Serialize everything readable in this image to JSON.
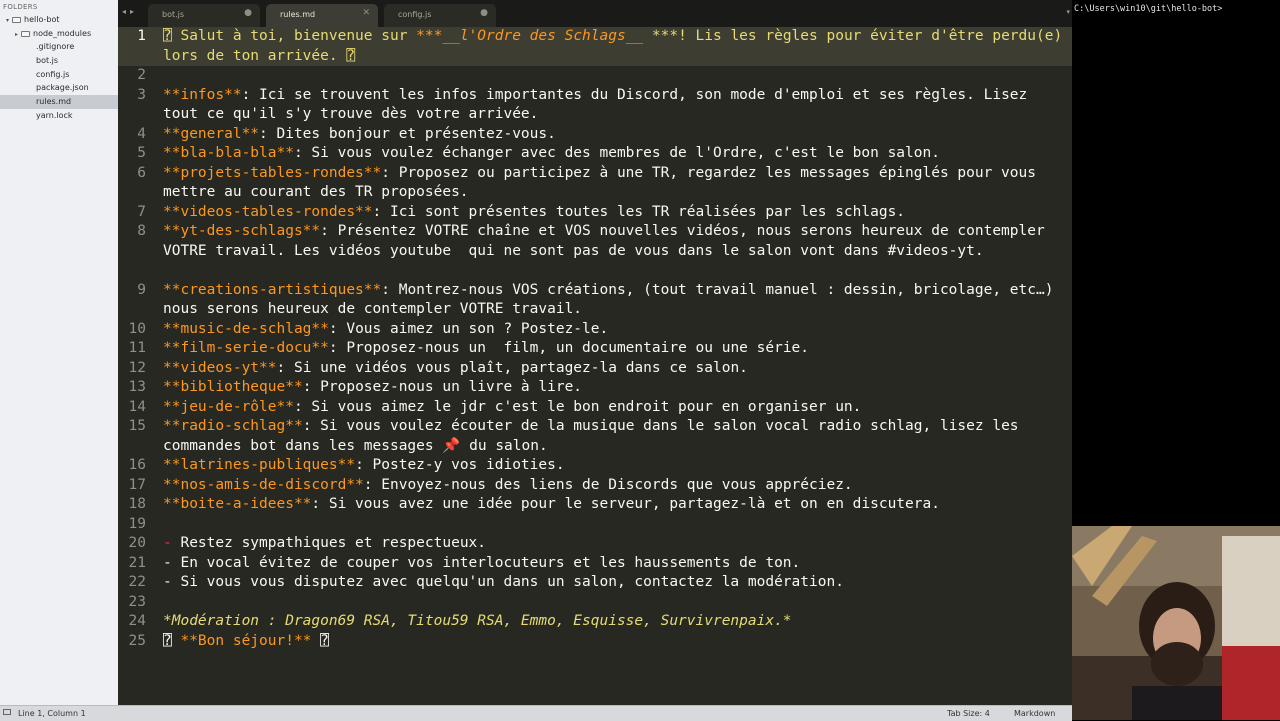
{
  "sidebar": {
    "header": "FOLDERS",
    "root": "hello-bot",
    "items": [
      "node_modules",
      ".gitignore",
      "bot.js",
      "config.js",
      "package.json",
      "rules.md",
      "yarn.lock"
    ]
  },
  "tabs": [
    {
      "label": "bot.js",
      "close": "●"
    },
    {
      "label": "rules.md",
      "close": "✕"
    },
    {
      "label": "config.js",
      "close": "●"
    }
  ],
  "terminal": {
    "prompt": "C:\\Users\\win10\\git\\hello-bot>"
  },
  "status": {
    "position": "Line 1, Column 1",
    "tab_size": "Tab Size: 4",
    "syntax": "Markdown"
  },
  "editor": {
    "line_numbers": [
      "1",
      "2",
      "3",
      "4",
      "5",
      "6",
      "7",
      "8",
      "9",
      "10",
      "11",
      "12",
      "13",
      "14",
      "15",
      "16",
      "17",
      "18",
      "19",
      "20",
      "21",
      "22",
      "23",
      "24",
      "25"
    ],
    "lines": [
      {
        "a": "⍰ Salut à toi, bienvenue sur ",
        "b": "***__",
        "c": "l'Ordre des Schlags__",
        "d": " ***! Lis les règles pour éviter d'être perdu(e) lors de ton arrivée. ⍰"
      },
      {
        "t": ""
      },
      {
        "k": "**infos**",
        "t": ": Ici se trouvent les infos importantes du Discord, son mode d'emploi et ses règles. Lisez tout ce qu'il s'y trouve dès votre arrivée."
      },
      {
        "k": "**general**",
        "t": ": Dites bonjour et présentez-vous."
      },
      {
        "k": "**bla-bla-bla**",
        "t": ": Si vous voulez échanger avec des membres de l'Ordre, c'est le bon salon."
      },
      {
        "k": "**projets-tables-rondes**",
        "t": ": Proposez ou participez à une TR, regardez les messages épinglés pour vous mettre au courant des TR proposées."
      },
      {
        "k": "**videos-tables-rondes**",
        "t": ": Ici sont présentes toutes les TR réalisées par les schlags."
      },
      {
        "k": "**yt-des-schlags**",
        "t": ": Présentez VOTRE chaîne et VOS nouvelles vidéos, nous serons heureux de contempler VOTRE travail. Les vidéos youtube  qui ne sont pas de vous dans le salon vont dans #videos-yt."
      },
      {
        "k": "**creations-artistiques**",
        "t": ": Montrez-nous VOS créations, (tout travail manuel : dessin, bricolage, etc…) nous serons heureux de contempler VOTRE travail."
      },
      {
        "k": "**music-de-schlag**",
        "t": ": Vous aimez un son ? Postez-le."
      },
      {
        "k": "**film-serie-docu**",
        "t": ": Proposez-nous un  film, un documentaire ou une série."
      },
      {
        "k": "**videos-yt**",
        "t": ": Si une vidéos vous plaît, partagez-la dans ce salon."
      },
      {
        "k": "**bibliotheque**",
        "t": ": Proposez-nous un livre à lire."
      },
      {
        "k": "**jeu-de-rôle**",
        "t": ": Si vous aimez le jdr c'est le bon endroit pour en organiser un."
      },
      {
        "k": "**radio-schlag**",
        "t": ": Si vous voulez écouter de la musique dans le salon vocal radio schlag, lisez les commandes bot dans les messages 📌 du salon."
      },
      {
        "k": "**latrines-publiques**",
        "t": ": Postez-y vos idioties."
      },
      {
        "k": "**nos-amis-de-discord**",
        "t": ": Envoyez-nous des liens de Discords que vous appréciez."
      },
      {
        "k": "**boite-a-idees**",
        "t": ": Si vous avez une idée pour le serveur, partagez-là et on en discutera."
      },
      {
        "t": ""
      },
      {
        "dash": "-",
        "t": " Restez sympathiques et respectueux."
      },
      {
        "t": "- En vocal évitez de couper vos interlocuteurs et les haussements de ton."
      },
      {
        "t": "- Si vous vous disputez avec quelqu'un dans un salon, contactez la modération."
      },
      {
        "t": ""
      },
      {
        "ital": "*Modération : Dragon69 RSA, Titou59 RSA, Emmo, Esquisse, Survivrenpaix.*"
      },
      {
        "a": "⍰ ",
        "k": "**Bon séjour!**",
        "d": " ⍰"
      }
    ]
  }
}
